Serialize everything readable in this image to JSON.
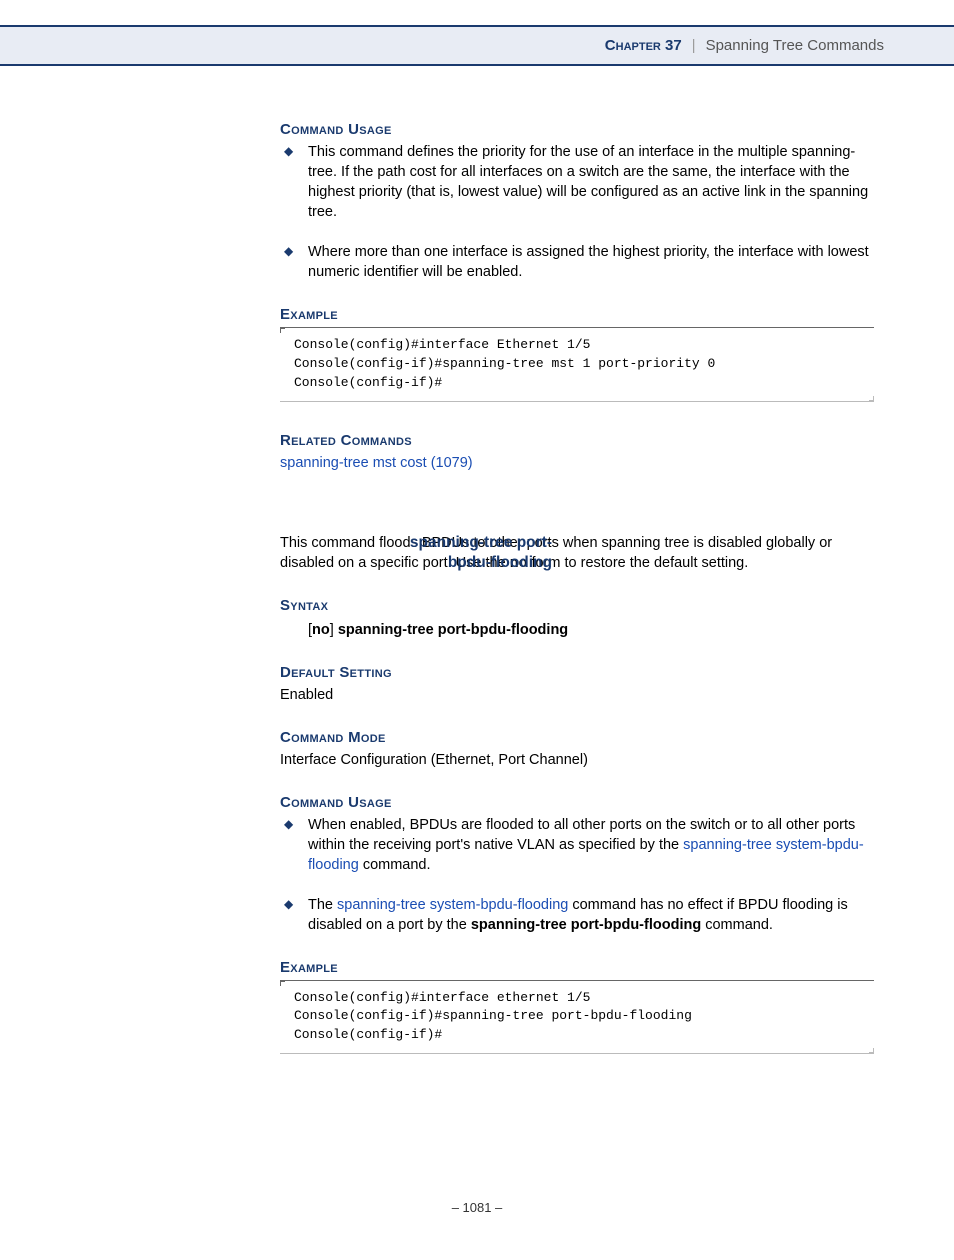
{
  "header": {
    "chapter_label": "Chapter 37",
    "separator": "|",
    "chapter_title": "Spanning Tree Commands"
  },
  "section1": {
    "usage_heading": "Command Usage",
    "bullets": [
      "This command defines the priority for the use of an interface in the multiple spanning-tree. If the path cost for all interfaces on a switch are the same, the interface with the highest priority (that is, lowest value) will be configured as an active link in the spanning tree.",
      "Where more than one interface is assigned the highest priority, the interface with lowest numeric identifier will be enabled."
    ],
    "example_heading": "Example",
    "code": "Console(config)#interface Ethernet 1/5\nConsole(config-if)#spanning-tree mst 1 port-priority 0\nConsole(config-if)#",
    "related_heading": "Related Commands",
    "related_link": "spanning-tree mst cost (1079)"
  },
  "section2": {
    "margin_title_l1": "spanning-tree port-",
    "margin_title_l2": "bpdu-flooding",
    "intro_pre": "This command floods BPDUs to other ports when spanning tree is disabled globally or disabled on a specific port. Use the ",
    "intro_bold": "no",
    "intro_post": " form to restore the default setting.",
    "syntax_heading": "Syntax",
    "syntax_nobracket_open": "[",
    "syntax_no": "no",
    "syntax_nobracket_close": "] ",
    "syntax_cmd": "spanning-tree port-bpdu-flooding",
    "default_heading": "Default Setting",
    "default_value": "Enabled",
    "mode_heading": "Command Mode",
    "mode_value": "Interface Configuration (Ethernet, Port Channel)",
    "usage_heading": "Command Usage",
    "bullet1_pre": "When enabled, BPDUs are flooded to all other ports on the switch or to all other ports within the receiving port's native VLAN as specified by the ",
    "bullet1_link": "spanning-tree system-bpdu-flooding",
    "bullet1_post": " command.",
    "bullet2_pre": "The ",
    "bullet2_link": "spanning-tree system-bpdu-flooding",
    "bullet2_mid": " command has no effect if BPDU flooding is disabled on a port by the ",
    "bullet2_bold": "spanning-tree port-bpdu-flooding",
    "bullet2_post": " command.",
    "example_heading": "Example",
    "code": "Console(config)#interface ethernet 1/5\nConsole(config-if)#spanning-tree port-bpdu-flooding\nConsole(config-if)#"
  },
  "footer": {
    "page": "– 1081 –"
  }
}
